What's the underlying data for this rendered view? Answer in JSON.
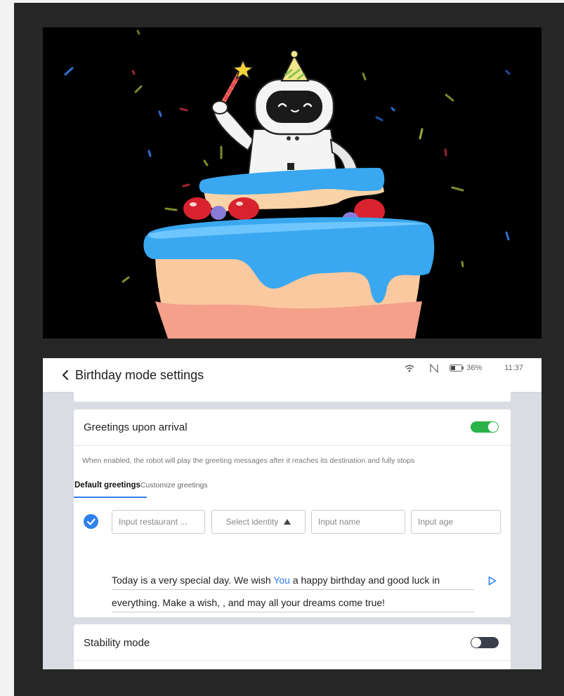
{
  "header": {
    "title": "Birthday mode settings"
  },
  "status_bar": {
    "battery": "36%",
    "time": "11:37"
  },
  "greetings": {
    "title": "Greetings upon arrival",
    "enabled": true,
    "description": "When enabled, the robot will play the greeting messages after it reaches its destination and fully stops",
    "tabs": [
      {
        "label": "Default greetings",
        "active": true
      },
      {
        "label": "Customize greetings",
        "active": false
      }
    ],
    "fields": {
      "restaurant_placeholder": "Input restaurant ...",
      "identity_label": "Select identity",
      "name_placeholder": "Input name",
      "age_placeholder": "Input age"
    },
    "message": {
      "line1_before": "Today is a very special day. We wish ",
      "line1_highlight": "You",
      "line1_after": " a happy birthday and good luck in",
      "line2": "everything. Make a wish, , and may all your dreams come true!"
    }
  },
  "stability": {
    "title": "Stability mode",
    "enabled": false
  },
  "colors": {
    "accent": "#2f80ed",
    "toggle_on": "#2bb34a",
    "toggle_off": "#3a3f4b",
    "frame": "#262626"
  }
}
